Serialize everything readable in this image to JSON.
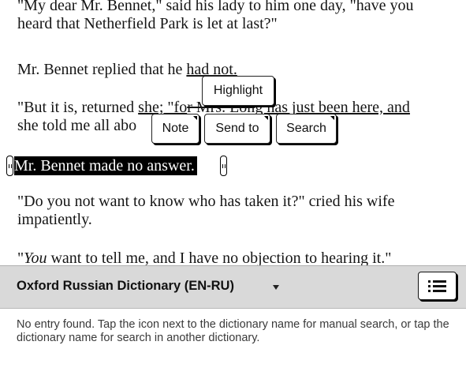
{
  "book": {
    "p1_line1": "\"My dear Mr. Bennet,\" said his lady to him one day, \"have you",
    "p1_line2": "heard that Netherfield Park is let at last?\"",
    "p2_a": "Mr. Bennet replied that he ",
    "p2_u": "had not.",
    "p3_l1_a": "\"But it is, returned ",
    "p3_l1_b": "she; \"fo",
    "p3_l1_c": "r Mrs. Lon",
    "p3_l1_d": "g has just been here, and",
    "p3_l2": "she told me all abo",
    "selected": "Mr. Bennet made no answer.",
    "p4_l1": "\"Do you not want to know who has taken it?\" cried his wife",
    "p4_l2": "impatiently.",
    "p5_a": "\"",
    "p5_em": "You",
    "p5_b": " want to tell me, and I have no objection to hearing it.\""
  },
  "popup": {
    "highlight": "Highlight",
    "note": "Note",
    "send_to": "Send to",
    "search": "Search"
  },
  "dictionary": {
    "name": "Oxford Russian Dictionary (EN-RU)",
    "message": "No entry found. Tap the icon next to the dictionary name for manual search, or tap the dictionary name for search in another dictionary.",
    "list_icon": "list-icon"
  }
}
